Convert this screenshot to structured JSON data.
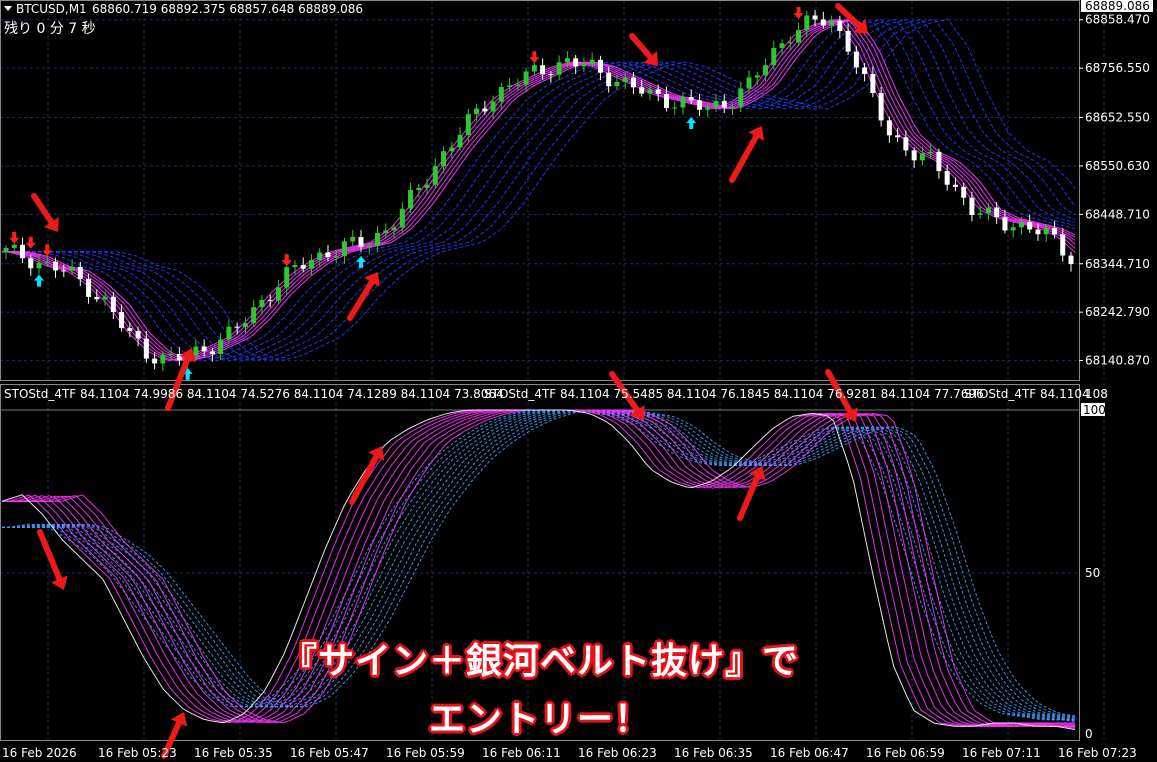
{
  "header": {
    "symbol": "BTCUSD,M1",
    "ohlc": "68860.719 68892.375 68857.648 68889.086",
    "remaining": "残り 0 分 7 秒",
    "current_price": "68889.086"
  },
  "subwindow": {
    "indicator_label": "STOStd_4TF 84.1104 74.9986 84.1104 74.5276 84.1104 74.1289 84.1104 73.8064",
    "indicator_label_2": "STOStd_4TF 84.1104 75.5485 84.1104 76.1845 84.1104 76.9281 84.1104 77.7696",
    "indicator_label_3": "STOStd_4TF 84.1104",
    "scale_top": "108",
    "level_100": "100",
    "level_50": "50",
    "level_0": "0"
  },
  "caption": {
    "line1": "『サイン＋銀河ベルト抜け』で",
    "line2": "エントリー！"
  },
  "colors": {
    "background": "#000000",
    "bull_candle": "#2ec82e",
    "bear_candle": "#ffffff",
    "ribbon_fast": "#ff33ff",
    "ribbon_slow": "#1f3cff",
    "arrow_annotation": "#ee1a1a",
    "buy_signal": "#00e5ff",
    "sell_signal": "#ff2020"
  },
  "chart_data": [
    {
      "type": "candlestick",
      "title": "BTCUSD,M1",
      "y_ticks": [
        "68858.470",
        "68756.550",
        "68652.550",
        "68550.630",
        "68448.710",
        "68344.710",
        "68242.790",
        "68140.870"
      ],
      "ylim": [
        68100,
        68900
      ],
      "x_tick_labels": [
        "16 Feb 2026",
        "16 Feb 05:23",
        "16 Feb 05:35",
        "16 Feb 05:47",
        "16 Feb 05:59",
        "16 Feb 06:11",
        "16 Feb 06:23",
        "16 Feb 06:35",
        "16 Feb 06:47",
        "16 Feb 06:59",
        "16 Feb 07:11",
        "16 Feb 07:23"
      ],
      "close_path": [
        68370,
        68360,
        68340,
        68330,
        68300,
        68260,
        68200,
        68160,
        68140,
        68150,
        68170,
        68190,
        68230,
        68280,
        68320,
        68350,
        68370,
        68380,
        68390,
        68420,
        68470,
        68530,
        68590,
        68640,
        68690,
        68720,
        68740,
        68760,
        68770,
        68760,
        68740,
        68720,
        68700,
        68690,
        68680,
        68670,
        68690,
        68720,
        68780,
        68830,
        68850,
        68860,
        68800,
        68700,
        68620,
        68580,
        68560,
        68520,
        68460,
        68440,
        68430,
        68420,
        68400,
        68360
      ],
      "sell_signals": [
        1,
        3,
        5,
        34,
        64,
        96
      ],
      "buy_signals": [
        4,
        22,
        43,
        83
      ]
    },
    {
      "type": "line",
      "title": "STOStd_4TF",
      "ylim": [
        0,
        108
      ],
      "y_ticks": [
        50,
        100
      ],
      "fast_path": [
        72,
        74,
        68,
        60,
        54,
        48,
        36,
        24,
        14,
        8,
        5,
        4,
        7,
        14,
        26,
        42,
        58,
        72,
        82,
        90,
        94,
        97,
        99,
        100,
        100,
        100,
        100,
        100,
        100,
        99,
        96,
        90,
        82,
        78,
        76,
        78,
        82,
        88,
        94,
        98,
        99,
        98,
        80,
        50,
        22,
        8,
        4,
        3,
        3,
        4,
        4,
        3,
        3,
        2
      ],
      "slow_path": [
        64,
        65,
        64,
        60,
        56,
        50,
        42,
        34,
        26,
        18,
        12,
        9,
        9,
        12,
        18,
        26,
        36,
        48,
        60,
        70,
        78,
        85,
        90,
        94,
        97,
        99,
        100,
        100,
        100,
        99,
        98,
        95,
        90,
        86,
        84,
        83,
        83,
        85,
        88,
        91,
        94,
        95,
        92,
        80,
        62,
        42,
        26,
        16,
        10,
        7,
        6,
        5,
        5,
        4
      ]
    }
  ]
}
